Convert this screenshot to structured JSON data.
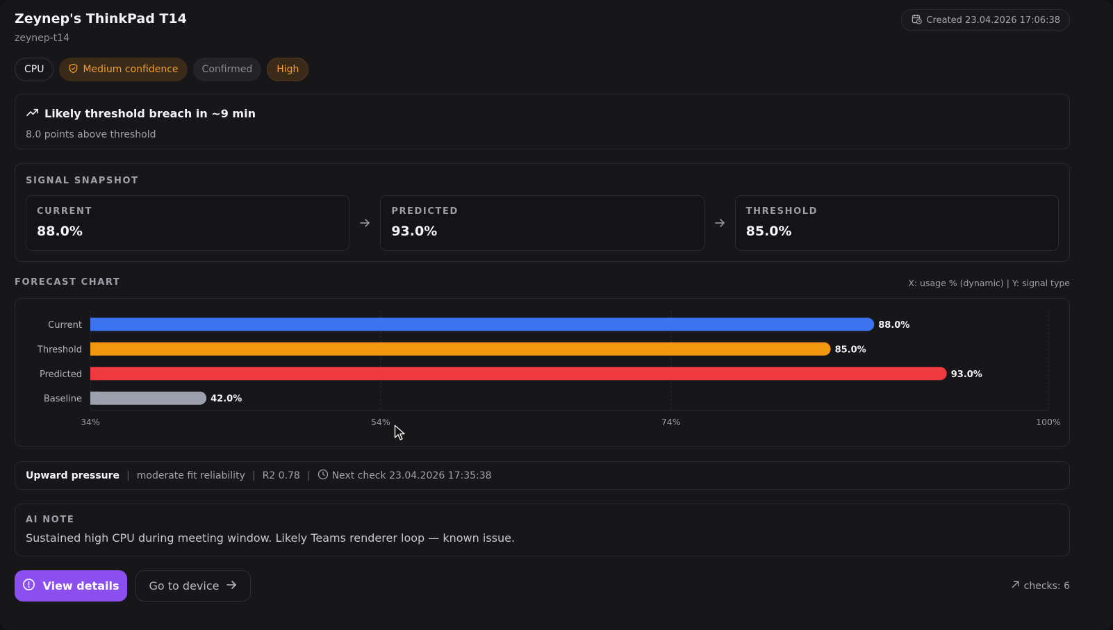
{
  "header": {
    "title": "Zeynep's ThinkPad T14",
    "hostname": "zeynep-t14",
    "created": "Created 23.04.2026 17:06:38"
  },
  "chips": {
    "metric": "CPU",
    "confidence": "Medium confidence",
    "status": "Confirmed",
    "severity": "High"
  },
  "breach": {
    "title": "Likely threshold breach in ~9 min",
    "subtitle": "8.0 points above threshold"
  },
  "snapshot": {
    "label": "SIGNAL SNAPSHOT",
    "items": [
      {
        "label": "CURRENT",
        "value": "88.0%"
      },
      {
        "label": "PREDICTED",
        "value": "93.0%"
      },
      {
        "label": "THRESHOLD",
        "value": "85.0%"
      }
    ]
  },
  "forecast": {
    "label": "FORECAST CHART",
    "axes_note": "X: usage % (dynamic) | Y: signal type"
  },
  "chart_data": {
    "type": "bar",
    "orientation": "horizontal",
    "categories": [
      "Current",
      "Threshold",
      "Predicted",
      "Baseline"
    ],
    "values": [
      88.0,
      85.0,
      93.0,
      42.0
    ],
    "value_labels": [
      "88.0%",
      "85.0%",
      "93.0%",
      "42.0%"
    ],
    "colors": [
      "#3b73f0",
      "#f2980f",
      "#ef3a3f",
      "#9da0ad"
    ],
    "xlim": [
      34,
      100
    ],
    "xticks": [
      34,
      54,
      74,
      100
    ],
    "xtick_labels": [
      "34%",
      "54%",
      "74%",
      "100%"
    ],
    "grid": true
  },
  "stats": {
    "trend": "Upward pressure",
    "fit": "moderate fit reliability",
    "r2": "R2 0.78",
    "next_check": "Next check 23.04.2026 17:35:38"
  },
  "note": {
    "label": "AI NOTE",
    "text": "Sustained high CPU during meeting window. Likely Teams renderer loop — known issue."
  },
  "actions": {
    "view_details": "View details",
    "go_to_device": "Go to device",
    "checks": "checks: 6"
  },
  "colors": {
    "accent": "#8b4ff0",
    "warning": "#f29e2e"
  }
}
